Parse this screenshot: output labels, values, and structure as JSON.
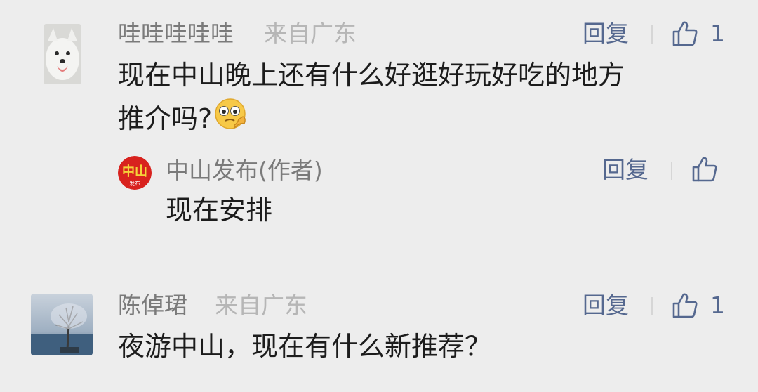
{
  "comments": [
    {
      "author": "哇哇哇哇哇",
      "location": "来自广东",
      "text_line1": "现在中山晚上还有什么好逛好玩好吃的地方",
      "text_line2": "推介吗?",
      "emoji": "thinking-face-emoji",
      "reply_label": "回复",
      "likes": "1",
      "reply": {
        "author": "中山发布(作者)",
        "text": "现在安排",
        "reply_label": "回复",
        "avatar_text": "中山",
        "avatar_subtext": "发布"
      }
    },
    {
      "author": "陈倬珺",
      "location": "来自广东",
      "text": "夜游中山，现在有什么新推荐？",
      "reply_label": "回复",
      "likes": "1"
    }
  ],
  "colors": {
    "background": "#ededed",
    "link": "#55688f",
    "name": "#7a7a7a",
    "location": "#b6b6b6",
    "text": "#1c1c1c",
    "brand_red": "#d8221e"
  }
}
